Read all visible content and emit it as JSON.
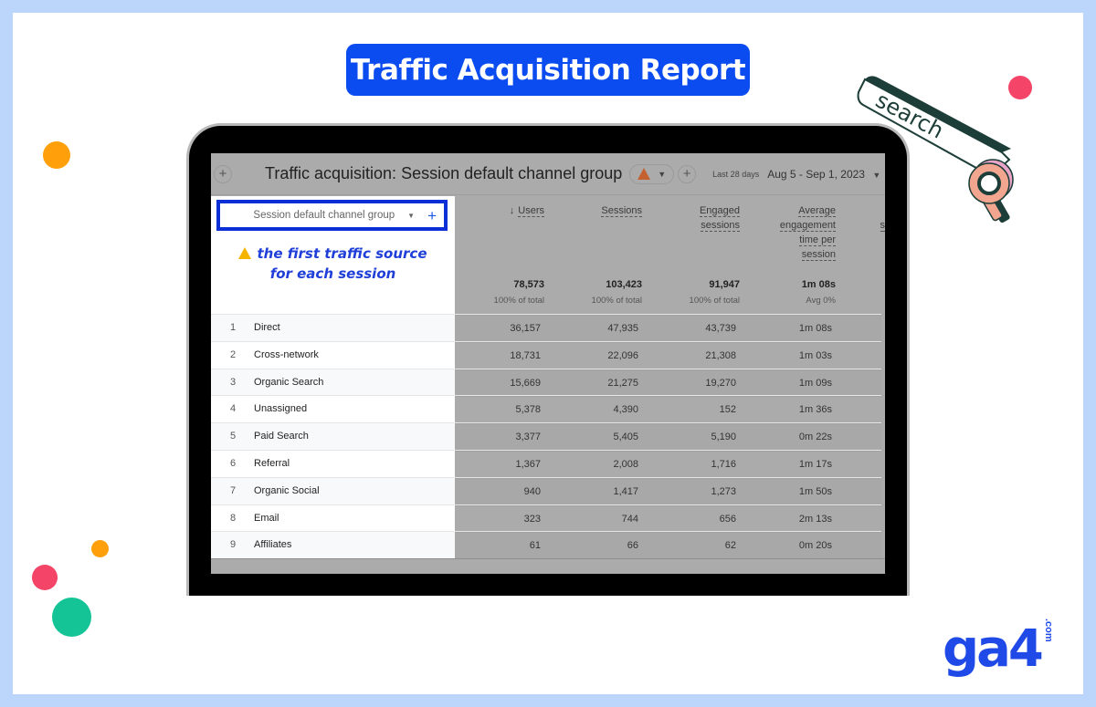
{
  "banner": {
    "title": "Traffic Acquisition Report"
  },
  "colors": {
    "banner_bg": "#0a4cf0",
    "page_border": "#bcd6fb",
    "highlight_box": "#0a2fd6",
    "note_text": "#1f3fd8",
    "dot_orange": "#ffa00a",
    "dot_pink": "#f44468",
    "dot_green": "#14c497",
    "logo": "#1f4ae8"
  },
  "decor": {
    "search_tag_label": "search"
  },
  "report": {
    "add_comparison_icon": "plus-icon",
    "title": "Traffic acquisition: Session default channel group",
    "warning_icon": "warning-triangle-icon",
    "date_label": "Last 28 days",
    "date_range": "Aug 5 - Sep 1, 2023",
    "dimension": {
      "label": "Session default channel group"
    },
    "note": {
      "line1": "the first traffic source",
      "line2": "for each session"
    },
    "columns": [
      {
        "label": "Users",
        "sorted": "desc",
        "total": "78,573",
        "subtotal": "100% of total"
      },
      {
        "label": "Sessions",
        "total": "103,423",
        "subtotal": "100% of total"
      },
      {
        "label_lines": [
          "Engaged",
          "sessions"
        ],
        "total": "91,947",
        "subtotal": "100% of total"
      },
      {
        "label_lines": [
          "Average",
          "engagement",
          "time per",
          "session"
        ],
        "total": "1m 08s",
        "subtotal": "Avg 0%"
      }
    ],
    "partial_column_label": "s",
    "rows": [
      {
        "index": "1",
        "channel": "Direct",
        "users": "36,157",
        "sessions": "47,935",
        "engaged": "43,739",
        "avg_time": "1m 08s"
      },
      {
        "index": "2",
        "channel": "Cross-network",
        "users": "18,731",
        "sessions": "22,096",
        "engaged": "21,308",
        "avg_time": "1m 03s"
      },
      {
        "index": "3",
        "channel": "Organic Search",
        "users": "15,669",
        "sessions": "21,275",
        "engaged": "19,270",
        "avg_time": "1m 09s"
      },
      {
        "index": "4",
        "channel": "Unassigned",
        "users": "5,378",
        "sessions": "4,390",
        "engaged": "152",
        "avg_time": "1m 36s"
      },
      {
        "index": "5",
        "channel": "Paid Search",
        "users": "3,377",
        "sessions": "5,405",
        "engaged": "5,190",
        "avg_time": "0m 22s"
      },
      {
        "index": "6",
        "channel": "Referral",
        "users": "1,367",
        "sessions": "2,008",
        "engaged": "1,716",
        "avg_time": "1m 17s"
      },
      {
        "index": "7",
        "channel": "Organic Social",
        "users": "940",
        "sessions": "1,417",
        "engaged": "1,273",
        "avg_time": "1m 50s"
      },
      {
        "index": "8",
        "channel": "Email",
        "users": "323",
        "sessions": "744",
        "engaged": "656",
        "avg_time": "2m 13s"
      },
      {
        "index": "9",
        "channel": "Affiliates",
        "users": "61",
        "sessions": "66",
        "engaged": "62",
        "avg_time": "0m 20s"
      }
    ]
  },
  "logo": {
    "main": "ga4",
    "suffix": ".com"
  }
}
